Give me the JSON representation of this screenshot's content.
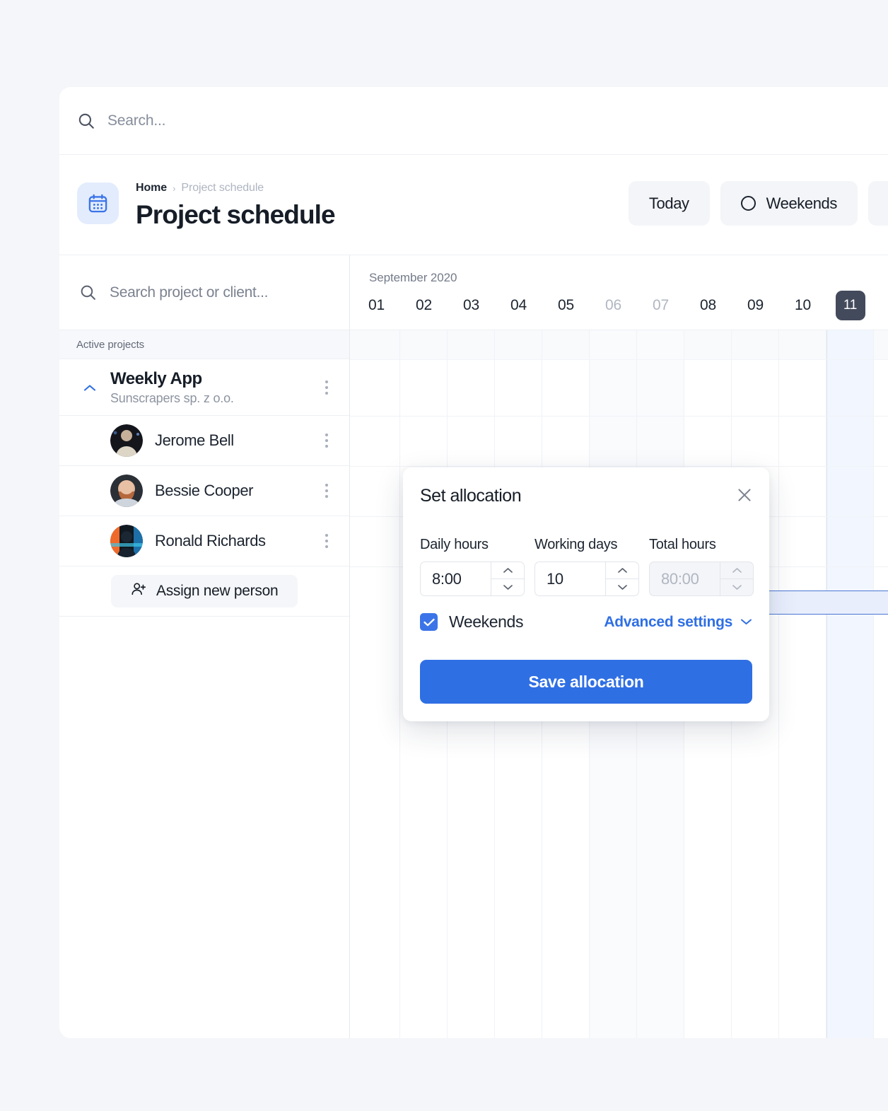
{
  "theme": {
    "page_bg": "#f4f6fa",
    "accent_blue": "#2f6fe4",
    "today_chip": "#434a5c",
    "alloc_fill": "#e8eefc",
    "alloc_border": "#4a77d4"
  },
  "global_search": {
    "placeholder": "Search...",
    "value": "",
    "icon": "search-icon"
  },
  "header": {
    "icon": "calendar-icon",
    "breadcrumb": {
      "home": "Home",
      "separator": "›",
      "current": "Project schedule"
    },
    "title": "Project schedule",
    "actions": [
      {
        "label": "Today",
        "icon": null
      },
      {
        "label": "Weekends",
        "icon": "circle-icon"
      },
      {
        "label": "",
        "icon": null
      }
    ]
  },
  "sidebar": {
    "search": {
      "placeholder": "Search project or client...",
      "value": "",
      "icon": "search-icon"
    },
    "section_title": "Active projects",
    "project": {
      "name": "Weekly App",
      "client": "Sunscrapers sp. z o.o.",
      "expanded": true,
      "chevron": "chevron-up-icon",
      "menu_icon": "kebab-menu-icon"
    },
    "people": [
      {
        "name": "Jerome Bell",
        "avatar": "photo-avatar-1",
        "menu_icon": "kebab-menu-icon"
      },
      {
        "name": "Bessie Cooper",
        "avatar": "photo-avatar-2",
        "menu_icon": "kebab-menu-icon"
      },
      {
        "name": "Ronald Richards",
        "avatar": "photo-avatar-3",
        "menu_icon": "kebab-menu-icon"
      }
    ],
    "assign_button": {
      "label": "Assign new person",
      "icon": "person-add-icon"
    }
  },
  "timeline": {
    "month_label": "September 2020",
    "days": [
      {
        "label": "01",
        "weekend": false,
        "today": false
      },
      {
        "label": "02",
        "weekend": false,
        "today": false
      },
      {
        "label": "03",
        "weekend": false,
        "today": false
      },
      {
        "label": "04",
        "weekend": false,
        "today": false
      },
      {
        "label": "05",
        "weekend": false,
        "today": false
      },
      {
        "label": "06",
        "weekend": true,
        "today": false
      },
      {
        "label": "07",
        "weekend": true,
        "today": false
      },
      {
        "label": "08",
        "weekend": false,
        "today": false
      },
      {
        "label": "09",
        "weekend": false,
        "today": false
      },
      {
        "label": "10",
        "weekend": false,
        "today": false
      },
      {
        "label": "11",
        "weekend": false,
        "today": true
      }
    ],
    "allocation_bar": {
      "name": "allocation-bar",
      "handle": "drag-handle"
    }
  },
  "popover": {
    "title": "Set allocation",
    "close_icon": "close-icon",
    "fields": [
      {
        "label": "Daily hours",
        "value": "8:00",
        "disabled": false
      },
      {
        "label": "Working days",
        "value": "10",
        "disabled": false
      },
      {
        "label": "Total hours",
        "value": "80:00",
        "disabled": true
      }
    ],
    "weekends": {
      "label": "Weekends",
      "checked": true,
      "icon": "checkbox-checked-icon"
    },
    "advanced": {
      "label": "Advanced settings",
      "icon": "chevron-down-icon"
    },
    "save_button": "Save allocation"
  }
}
